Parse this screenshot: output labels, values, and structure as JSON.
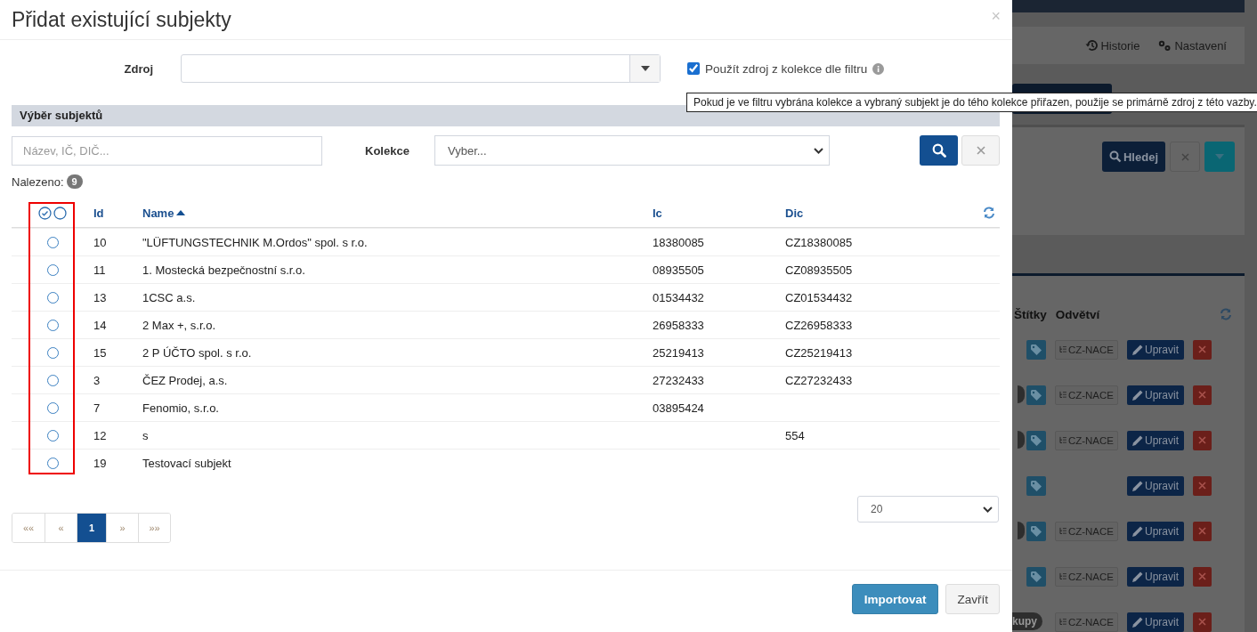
{
  "dialog": {
    "title": "Přidat existující subjekty",
    "close": "×"
  },
  "source": {
    "label": "Zdroj"
  },
  "use_collection_source": {
    "label": "Použít zdroj z kolekce dle filtru",
    "checked": true
  },
  "tooltip": "Pokud je ve filtru vybrána kolekce a vybraný subjekt je do tého kolekce přiřazen, použije se primárně zdroj z této vazby.",
  "section_title": "Výběr subjektů",
  "search": {
    "placeholder": "Název, IČ, DIČ..."
  },
  "collection": {
    "label": "Kolekce",
    "value": "Vyber..."
  },
  "found": {
    "label": "Nalezeno:",
    "count": "9"
  },
  "table": {
    "highlighted": true,
    "columns": [
      {
        "kind": "select"
      },
      {
        "kind": "text",
        "label": "Id",
        "sorted": false
      },
      {
        "kind": "text",
        "label": "Name",
        "sorted": true
      },
      {
        "kind": "text",
        "label": "Ic",
        "sorted": false
      },
      {
        "kind": "text",
        "label": "Dic",
        "sorted": false
      }
    ],
    "rows": [
      {
        "selected": false,
        "id": "10",
        "name": "\"LÜFTUNGSTECHNIK M.Ordos\" spol. s r.o.",
        "ic": "18380085",
        "dic": "CZ18380085"
      },
      {
        "selected": false,
        "id": "11",
        "name": "1. Mostecká bezpečnostní s.r.o.",
        "ic": "08935505",
        "dic": "CZ08935505"
      },
      {
        "selected": false,
        "id": "13",
        "name": "1CSC a.s.",
        "ic": "01534432",
        "dic": "CZ01534432"
      },
      {
        "selected": false,
        "id": "14",
        "name": "2 Max +, s.r.o.",
        "ic": "26958333",
        "dic": "CZ26958333"
      },
      {
        "selected": false,
        "id": "15",
        "name": "2 P ÚČTO spol. s r.o.",
        "ic": "25219413",
        "dic": "CZ25219413"
      },
      {
        "selected": false,
        "id": "3",
        "name": "ČEZ Prodej, a.s.",
        "ic": "27232433",
        "dic": "CZ27232433"
      },
      {
        "selected": false,
        "id": "7",
        "name": "Fenomio, s.r.o.",
        "ic": "03895424"
      },
      {
        "selected": false,
        "id": "12",
        "name": "s",
        "dic": "554"
      },
      {
        "selected": false,
        "id": "19",
        "name": "Testovací subjekt"
      }
    ]
  },
  "pagination": [
    {
      "label": "««",
      "selected": false
    },
    {
      "label": "«",
      "selected": false
    },
    {
      "label": "1",
      "selected": true
    },
    {
      "label": "»",
      "selected": false
    },
    {
      "label": "»»",
      "selected": false
    }
  ],
  "page_size": "20",
  "footer": [
    {
      "label": "Importovat",
      "kind": "primary"
    },
    {
      "label": "Zavřít",
      "kind": "default"
    }
  ],
  "background": {
    "toolbar": [
      {
        "label": "Historie",
        "kind": "history"
      },
      {
        "label": "Nastavení",
        "kind": "settings"
      }
    ],
    "search_button": "Hledej",
    "columns": [
      "Štítky",
      "Odvětví"
    ],
    "rows": [
      {
        "badge": false,
        "nace": "CZ-NACE",
        "edit": "Upravit"
      },
      {
        "badge": true,
        "nace": "CZ-NACE",
        "edit": "Upravit"
      },
      {
        "badge": true,
        "nace": "CZ-NACE",
        "edit": "Upravit"
      },
      {
        "badge": false,
        "edit": "Upravit"
      },
      {
        "badge": true,
        "nace": "CZ-NACE",
        "edit": "Upravit"
      },
      {
        "badge": false,
        "nace": "CZ-NACE",
        "edit": "Upravit"
      },
      {
        "badge": true,
        "badge_text": "kupy",
        "nace": "CZ-NACE",
        "edit": "Upravit"
      }
    ]
  }
}
